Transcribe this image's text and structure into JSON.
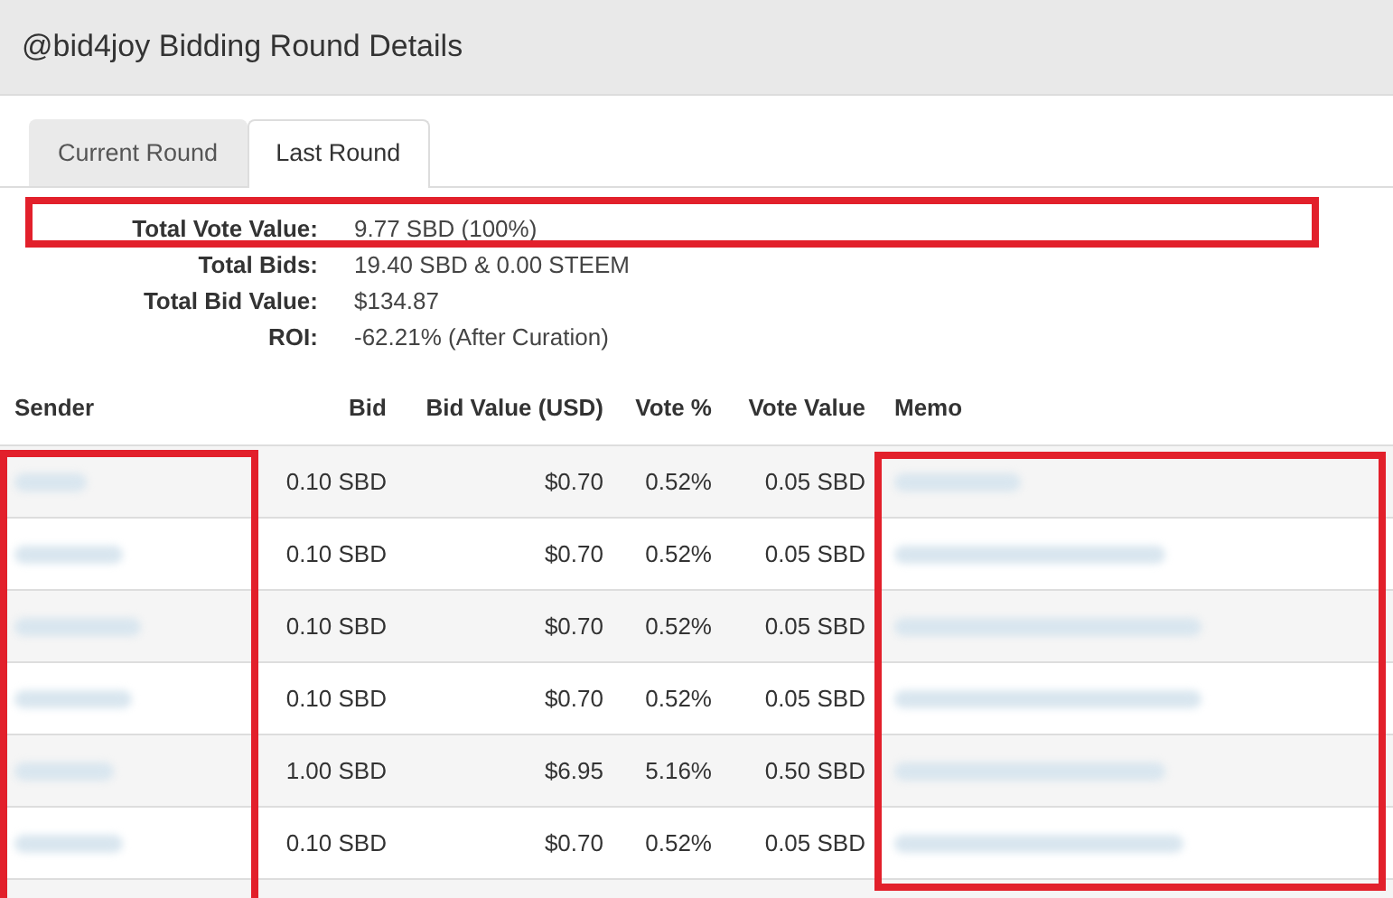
{
  "window": {
    "title": "@bid4joy Bidding Round Details"
  },
  "tabs": [
    {
      "label": "Current Round",
      "selected": false
    },
    {
      "label": "Last Round",
      "selected": true
    }
  ],
  "summary": [
    {
      "label": "Total Vote Value:",
      "value": "9.77 SBD (100%)"
    },
    {
      "label": "Total Bids:",
      "value": "19.40 SBD & 0.00 STEEM"
    },
    {
      "label": "Total Bid Value:",
      "value": "$134.87"
    },
    {
      "label": "ROI:",
      "value": "-62.21% (After Curation)"
    }
  ],
  "table": {
    "columns": [
      "Sender",
      "Bid",
      "Bid Value (USD)",
      "Vote %",
      "Vote Value",
      "Memo"
    ],
    "rows": [
      {
        "bid": "0.10 SBD",
        "bid_value": "$0.70",
        "vote_pct": "0.52%",
        "vote_value": "0.05 SBD"
      },
      {
        "bid": "0.10 SBD",
        "bid_value": "$0.70",
        "vote_pct": "0.52%",
        "vote_value": "0.05 SBD"
      },
      {
        "bid": "0.10 SBD",
        "bid_value": "$0.70",
        "vote_pct": "0.52%",
        "vote_value": "0.05 SBD"
      },
      {
        "bid": "0.10 SBD",
        "bid_value": "$0.70",
        "vote_pct": "0.52%",
        "vote_value": "0.05 SBD"
      },
      {
        "bid": "1.00 SBD",
        "bid_value": "$6.95",
        "vote_pct": "5.16%",
        "vote_value": "0.50 SBD"
      },
      {
        "bid": "0.10 SBD",
        "bid_value": "$0.70",
        "vote_pct": "0.52%",
        "vote_value": "0.05 SBD"
      }
    ]
  }
}
